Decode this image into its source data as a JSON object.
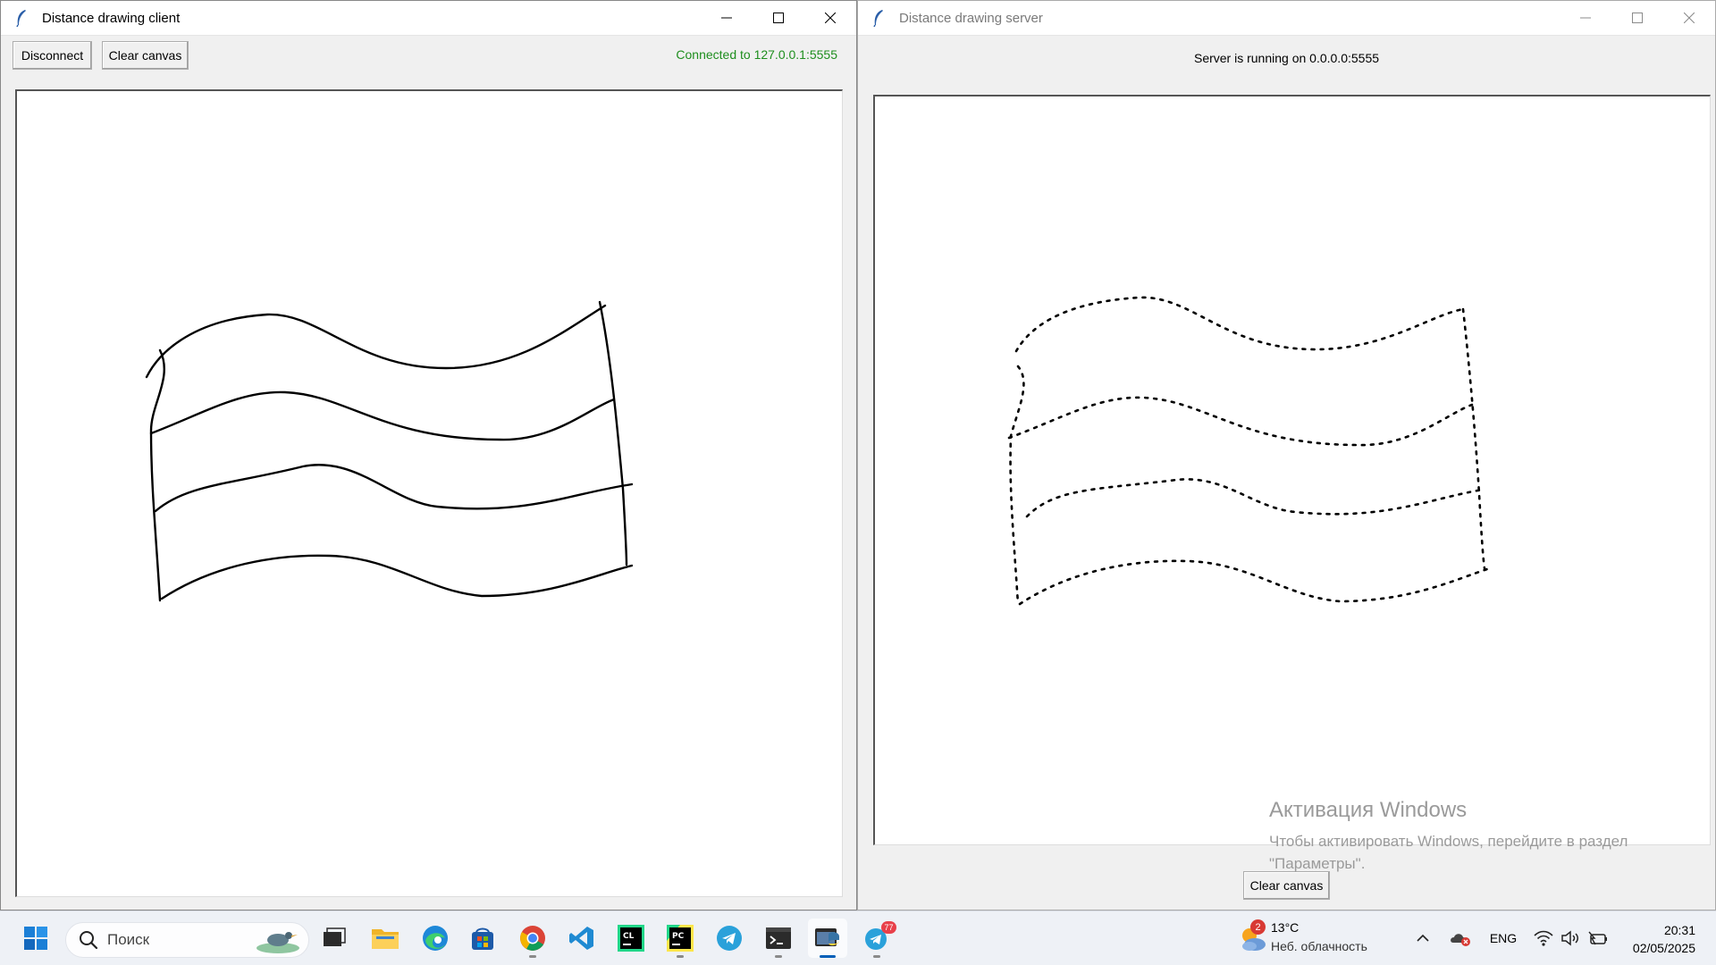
{
  "client": {
    "title": "Distance drawing client",
    "disconnect_label": "Disconnect",
    "clear_label": "Clear canvas",
    "status": "Connected to 127.0.0.1:5555",
    "status_color": "#1e8e1e"
  },
  "server": {
    "title": "Distance drawing server",
    "status": "Server is running on 0.0.0.0:5555",
    "clear_label": "Clear canvas"
  },
  "activation": {
    "title": "Активация Windows",
    "text_line1": "Чтобы активировать Windows, перейдите в раздел",
    "text_line2": "\"Параметры\"."
  },
  "taskbar": {
    "search_placeholder": "Поиск",
    "weather_temp": "13°C",
    "weather_desc": "Неб. облачность",
    "weather_badge": "2",
    "language": "ENG",
    "time": "20:31",
    "date": "02/05/2025",
    "telegram_badge": "77",
    "apps": [
      "start",
      "search",
      "task-view",
      "file-explorer",
      "edge",
      "microsoft-store",
      "chrome",
      "vscode",
      "clion",
      "pycharm",
      "telegram",
      "terminal",
      "python-tk",
      "telegram-desktop"
    ]
  },
  "colors": {
    "accent": "#005fb8",
    "stroke": "#000000",
    "status_green": "#1e8e1e"
  }
}
